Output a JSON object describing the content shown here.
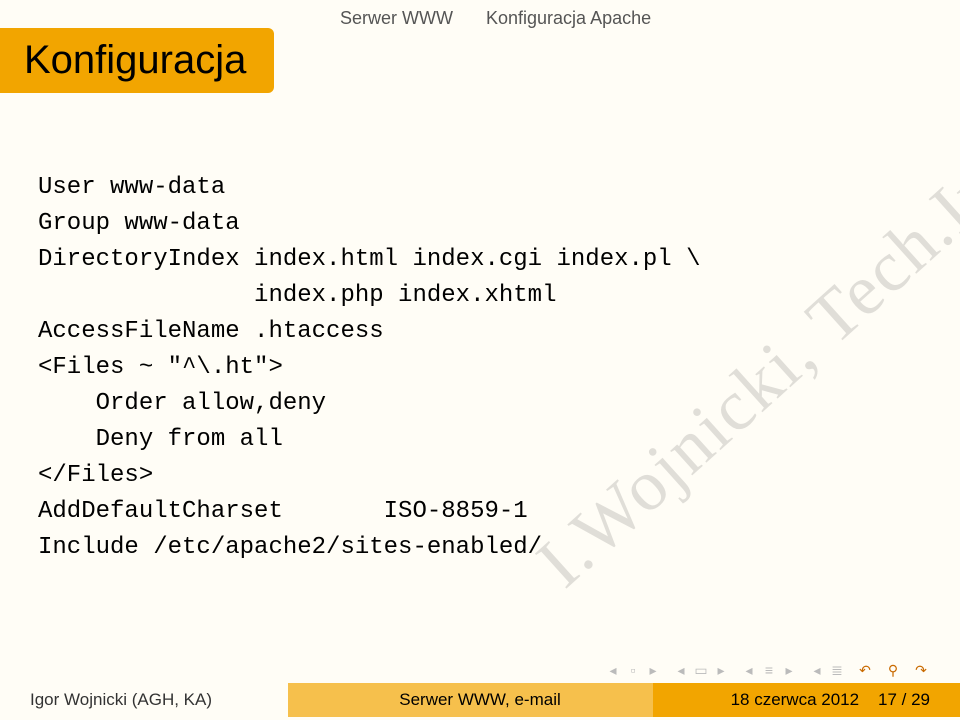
{
  "breadcrumb": {
    "left": "Serwer WWW",
    "right": "Konfiguracja Apache"
  },
  "title": "Konfiguracja",
  "code": {
    "line1": "User www-data",
    "line2": "Group www-data",
    "line3": "DirectoryIndex index.html index.cgi index.pl \\",
    "line4": "               index.php index.xhtml",
    "line5": "AccessFileName .htaccess",
    "line6": "<Files ~ \"^\\.ht\">",
    "line7": "    Order allow,deny",
    "line8": "    Deny from all",
    "line9": "</Files>",
    "line10": "AddDefaultCharset       ISO-8859-1",
    "line11": "Include /etc/apache2/sites-enabled/"
  },
  "watermark": "I.Wojnicki, Tech.Inter.",
  "footer": {
    "author": "Igor Wojnicki (AGH, KA)",
    "center": "Serwer WWW, e-mail",
    "date": "18 czerwca 2012",
    "page": "17 / 29"
  }
}
